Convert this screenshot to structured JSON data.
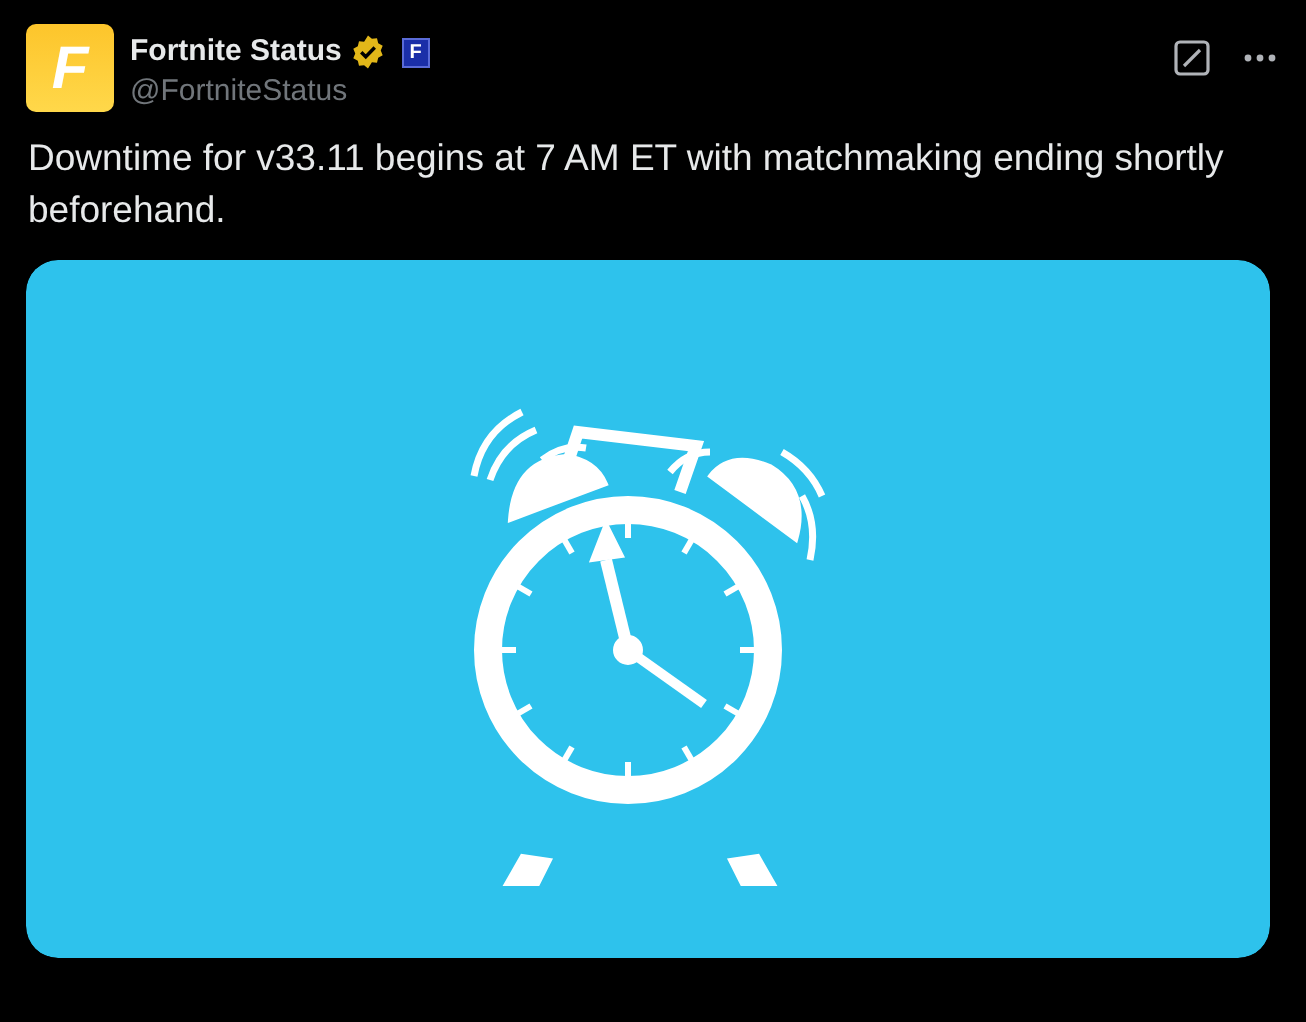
{
  "author": {
    "avatar_letter": "F",
    "name": "Fortnite Status",
    "verified": true,
    "affiliate_letter": "F",
    "handle": "@FortniteStatus"
  },
  "actions": [
    {
      "kind": "grok"
    },
    {
      "kind": "more"
    }
  ],
  "text": "Downtime for v33.11 begins at 7 AM ET with matchmaking ending shortly beforehand.",
  "media": {
    "kind": "illustration"
  }
}
